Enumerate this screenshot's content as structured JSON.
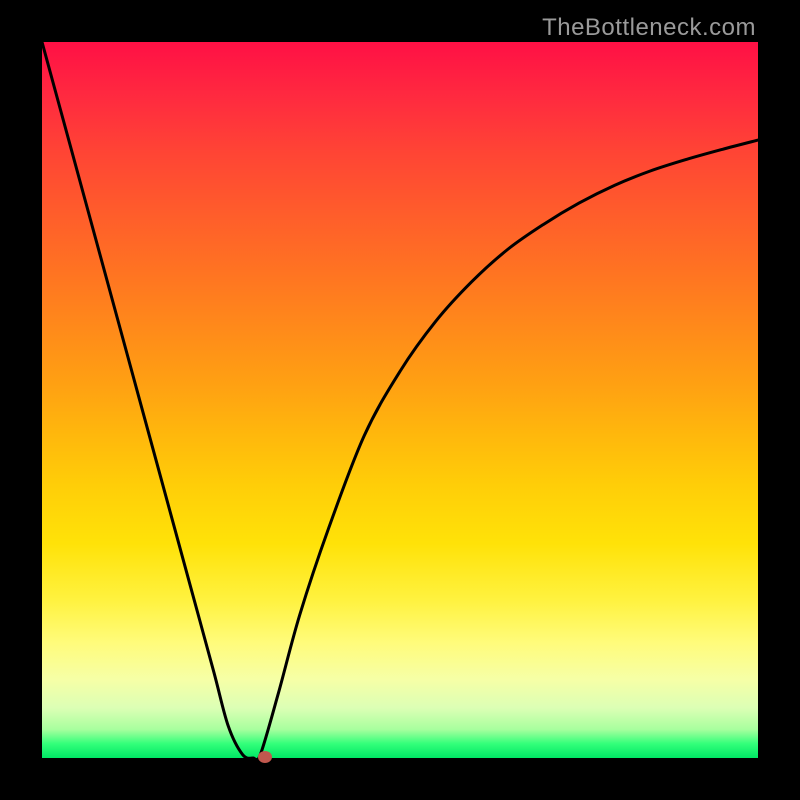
{
  "watermark": "TheBottleneck.com",
  "colors": {
    "frame": "#000000",
    "curve": "#000000",
    "marker": "#c1584e",
    "gradient_top": "#ff1045",
    "gradient_bottom": "#00e765"
  },
  "chart_data": {
    "type": "line",
    "title": "",
    "xlabel": "",
    "ylabel": "",
    "xlim": [
      0,
      100
    ],
    "ylim": [
      0,
      100
    ],
    "grid": false,
    "series": [
      {
        "name": "bottleneck-curve",
        "x": [
          0,
          3,
          6,
          9,
          12,
          15,
          18,
          21,
          24,
          26,
          28,
          29.5,
          30.5,
          33,
          36,
          40,
          45,
          50,
          55,
          60,
          65,
          70,
          75,
          80,
          85,
          90,
          95,
          100
        ],
        "y": [
          100,
          89,
          78,
          67,
          56,
          45,
          34,
          23,
          12,
          4.5,
          0.5,
          0,
          0.5,
          9,
          20,
          32,
          45,
          54,
          61,
          66.5,
          71,
          74.5,
          77.5,
          80,
          82,
          83.6,
          85,
          86.3
        ]
      }
    ],
    "marker": {
      "x": 31.2,
      "y": 0.2
    }
  }
}
